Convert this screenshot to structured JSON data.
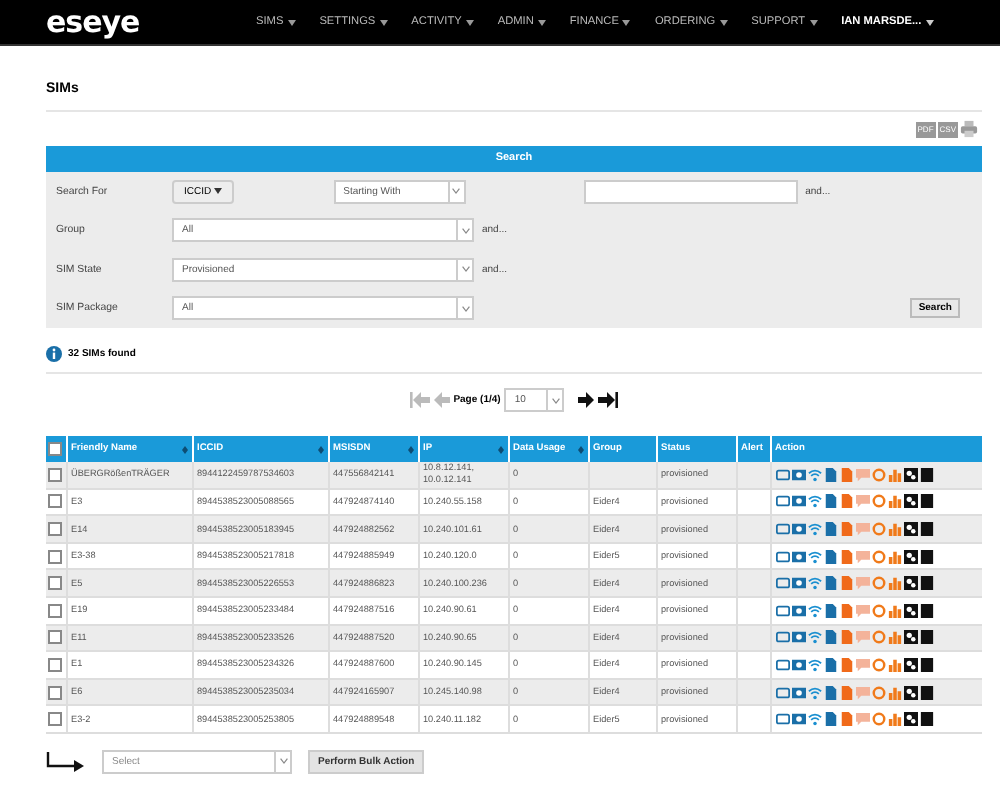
{
  "nav": {
    "logo": "eseye",
    "items": [
      "SIMS",
      "SETTINGS",
      "ACTIVITY",
      "ADMIN",
      "FINANCE",
      "ORDERING",
      "SUPPORT"
    ],
    "user": "IAN MARSDE..."
  },
  "page_title": "SIMs",
  "exports": [
    "PDF",
    "CSV"
  ],
  "search": {
    "title": "Search",
    "search_for": {
      "label": "Search For",
      "field_button": "ICCID",
      "match": "Starting With",
      "and": "and..."
    },
    "filters": [
      {
        "label": "Group",
        "value": "All",
        "and": "and..."
      },
      {
        "label": "SIM State",
        "value": "Provisioned",
        "and": "and..."
      },
      {
        "label": "SIM Package",
        "value": "All"
      }
    ],
    "button": "Search"
  },
  "results": "32 SIMs found",
  "pagination": {
    "label": "Page (1/4)",
    "page_size": "10"
  },
  "table": {
    "select_all_checked": false,
    "columns": [
      {
        "label": "Friendly Name",
        "sortable": true
      },
      {
        "label": "ICCID",
        "sortable": true
      },
      {
        "label": "MSISDN",
        "sortable": true
      },
      {
        "label": "IP",
        "sortable": true
      },
      {
        "label": "Data Usage",
        "sortable": true
      },
      {
        "label": "Group",
        "sortable": false
      },
      {
        "label": "Status",
        "sortable": false
      },
      {
        "label": "Alert",
        "sortable": false
      },
      {
        "label": "Action",
        "sortable": false
      }
    ],
    "rows": [
      {
        "name": "ÜBERGRößenTRÄGER",
        "iccid": "8944122459787534603",
        "msisdn": "447556842141",
        "ip": "10.8.12.141, 10.0.12.141",
        "usage": "0",
        "status": "provisioned",
        "checked": false
      },
      {
        "name": "E3",
        "iccid": "8944538523005088565",
        "msisdn": "447924874140",
        "ip": "10.240.55.158",
        "usage": "0",
        "group": "Eider4",
        "status": "provisioned",
        "checked": false
      },
      {
        "name": "E14",
        "iccid": "8944538523005183945",
        "msisdn": "447924882562",
        "ip": "10.240.101.61",
        "usage": "0",
        "group": "Eider4",
        "status": "provisioned",
        "checked": false
      },
      {
        "name": "E3-38",
        "iccid": "8944538523005217818",
        "msisdn": "447924885949",
        "ip": "10.240.120.0",
        "usage": "0",
        "group": "Eider5",
        "status": "provisioned",
        "checked": false
      },
      {
        "name": "E5",
        "iccid": "8944538523005226553",
        "msisdn": "447924886823",
        "ip": "10.240.100.236",
        "usage": "0",
        "group": "Eider4",
        "status": "provisioned",
        "checked": false
      },
      {
        "name": "E19",
        "iccid": "8944538523005233484",
        "msisdn": "447924887516",
        "ip": "10.240.90.61",
        "usage": "0",
        "group": "Eider4",
        "status": "provisioned",
        "checked": false
      },
      {
        "name": "E11",
        "iccid": "8944538523005233526",
        "msisdn": "447924887520",
        "ip": "10.240.90.65",
        "usage": "0",
        "group": "Eider4",
        "status": "provisioned",
        "checked": false
      },
      {
        "name": "E1",
        "iccid": "8944538523005234326",
        "msisdn": "447924887600",
        "ip": "10.240.90.145",
        "usage": "0",
        "group": "Eider4",
        "status": "provisioned",
        "checked": false
      },
      {
        "name": "E6",
        "iccid": "8944538523005235034",
        "msisdn": "447924165907",
        "ip": "10.245.140.98",
        "usage": "0",
        "group": "Eider4",
        "status": "provisioned",
        "checked": false
      },
      {
        "name": "E3-2",
        "iccid": "8944538523005253805",
        "msisdn": "447924889548",
        "ip": "10.240.11.182",
        "usage": "0",
        "group": "Eider5",
        "status": "provisioned",
        "checked": false
      }
    ]
  },
  "bulk": {
    "placeholder": "Select",
    "button": "Perform Bulk Action"
  }
}
